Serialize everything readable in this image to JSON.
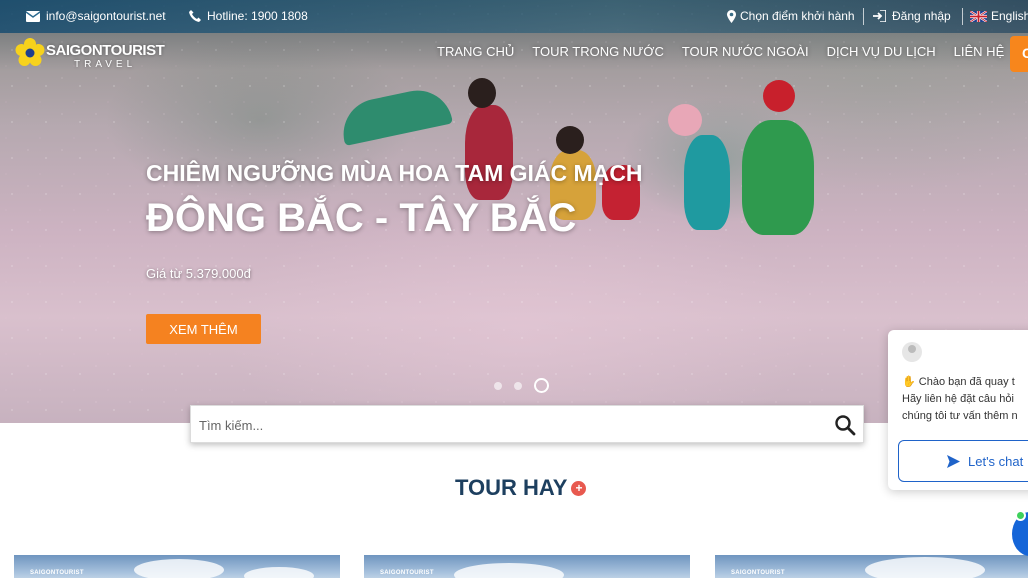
{
  "topbar": {
    "email": "info@saigontourist.net",
    "hotline": "Hotline: 1900 1808",
    "departure": "Chọn điểm khởi hành",
    "login": "Đăng nhập",
    "language": "English"
  },
  "logo": {
    "name": "SAIGONTOURIST",
    "sub": "TRAVEL"
  },
  "nav": {
    "items": [
      "TRANG CHỦ",
      "TOUR TRONG NƯỚC",
      "TOUR NƯỚC NGOÀI",
      "DỊCH VỤ DU LỊCH",
      "LIÊN HỆ"
    ],
    "cta_label": "C"
  },
  "hero": {
    "subtitle": "CHIÊM NGƯỠNG MÙA HOA TAM GIÁC MẠCH",
    "title": "ĐÔNG BẮC - TÂY BẮC",
    "price": "Giá từ 5.379.000đ",
    "button": "XEM THÊM",
    "slides": 3,
    "active_slide": 3
  },
  "search": {
    "placeholder": "Tìm kiếm..."
  },
  "section": {
    "title": "TOUR HAY",
    "badge": "+"
  },
  "cards": [
    {
      "logo": "SAIGONTOURIST"
    },
    {
      "logo": "SAIGONTOURIST"
    },
    {
      "logo": "SAIGONTOURIST"
    }
  ],
  "chat": {
    "line1": "Chào bạn đã quay t",
    "line2": "Hãy liên hệ đặt câu hỏi",
    "line3": "chúng tôi tư vấn thêm n",
    "button": "Let's chat"
  },
  "colors": {
    "accent": "#f58220",
    "navy": "#1d3f5f",
    "chat_blue": "#1f63c9"
  }
}
